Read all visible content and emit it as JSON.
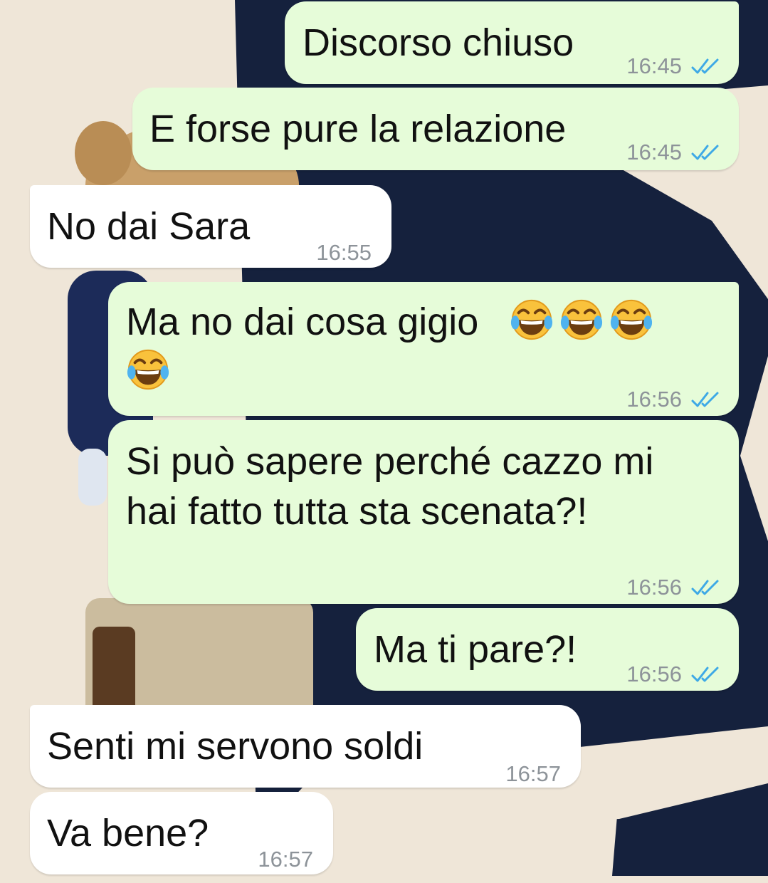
{
  "colors": {
    "outgoing_bubble": "#e6fcd9",
    "incoming_bubble": "#ffffff",
    "read_ticks": "#3ea9e6",
    "wallpaper_light": "#efe6d8",
    "wallpaper_navy": "#15213d"
  },
  "messages": [
    {
      "direction": "outgoing",
      "text": "Discorso chiuso",
      "time": "16:45",
      "status": "read"
    },
    {
      "direction": "outgoing",
      "text": "E forse pure la relazione",
      "time": "16:45",
      "status": "read"
    },
    {
      "direction": "incoming",
      "text": "No dai Sara",
      "time": "16:55"
    },
    {
      "direction": "outgoing",
      "text": "Ma no dai cosa gigio",
      "emoji": "face-with-tears-of-joy",
      "emoji_count": 4,
      "time": "16:56",
      "status": "read"
    },
    {
      "direction": "outgoing",
      "lines": [
        "Si può sapere perché cazzo mi",
        "hai fatto tutta sta scenata?!"
      ],
      "time": "16:56",
      "status": "read"
    },
    {
      "direction": "outgoing",
      "text": "Ma ti pare?!",
      "time": "16:56",
      "status": "read"
    },
    {
      "direction": "incoming",
      "text": "Senti mi servono soldi",
      "time": "16:57"
    },
    {
      "direction": "incoming",
      "text": "Va bene?",
      "time": "16:57"
    }
  ]
}
